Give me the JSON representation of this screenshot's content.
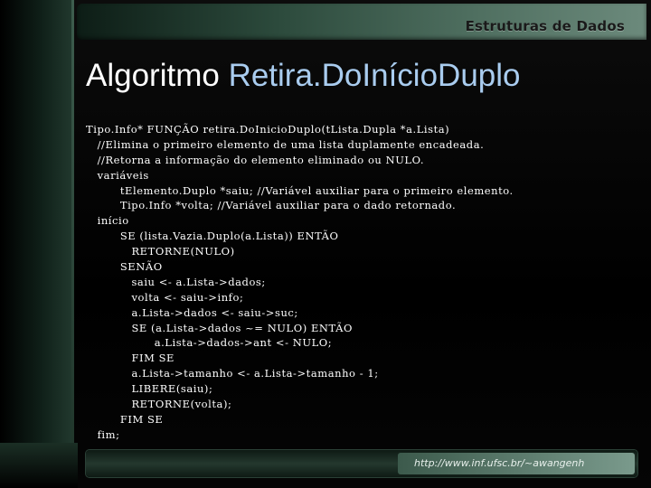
{
  "header": {
    "title": "Estruturas de Dados"
  },
  "slide": {
    "title_plain": "Algoritmo ",
    "title_accent": "Retira.DoIníciоDuplo"
  },
  "code_lines": [
    "Tipo.Info* FUNÇÃO retira.DoInicioDuplo(tLista.Dupla *a.Lista)",
    "   //Elimina o primeiro elemento de uma lista duplamente encadeada.",
    "   //Retorna a informação do elemento eliminado ou NULO.",
    "   variáveis",
    "         tElemento.Duplo *saiu; //Variável auxiliar para o primeiro elemento.",
    "         Tipo.Info *volta; //Variável auxiliar para o dado retornado.",
    "   início",
    "         SE (lista.Vazia.Duplo(a.Lista)) ENTÃO",
    "            RETORNE(NULO)",
    "         SENÃO",
    "            saiu <- a.Lista->dados;",
    "            volta <- saiu->info;",
    "            a.Lista->dados <- saiu->suc;",
    "            SE (a.Lista->dados ~= NULO) ENTÃO",
    "                  a.Lista->dados->ant <- NULO;",
    "            FIM SE",
    "            a.Lista->tamanho <- a.Lista->tamanho - 1;",
    "            LIBERE(saiu);",
    "            RETORNE(volta);",
    "         FIM SE",
    "   fim;"
  ],
  "footer": {
    "url": "http://www.inf.ufsc.br/~awangenh"
  },
  "colors": {
    "title_accent": "#a9ccef",
    "text": "#ffffff",
    "band_green": "#4f6f60"
  }
}
